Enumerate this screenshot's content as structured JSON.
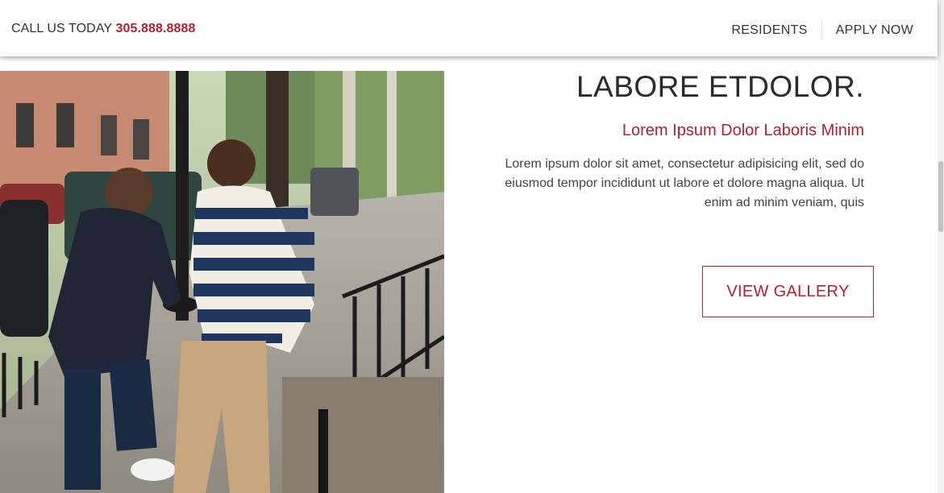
{
  "header": {
    "call_label": "CALL US TODAY",
    "phone": "305.888.8888",
    "nav": {
      "residents": "RESIDENTS",
      "apply_now": "APPLY NOW"
    }
  },
  "main": {
    "headline": "LABORE ETDOLOR.",
    "subheadline": "Lorem Ipsum Dolor Laboris Minim",
    "body": "Lorem ipsum dolor sit amet, consectetur adipisicing elit, sed do eiusmod tempor incididunt ut labore et dolore magna aliqua. Ut enim ad minim veniam, quis",
    "gallery_button": "VIEW GALLERY"
  },
  "colors": {
    "accent": "#b5202e",
    "text": "#333333"
  }
}
